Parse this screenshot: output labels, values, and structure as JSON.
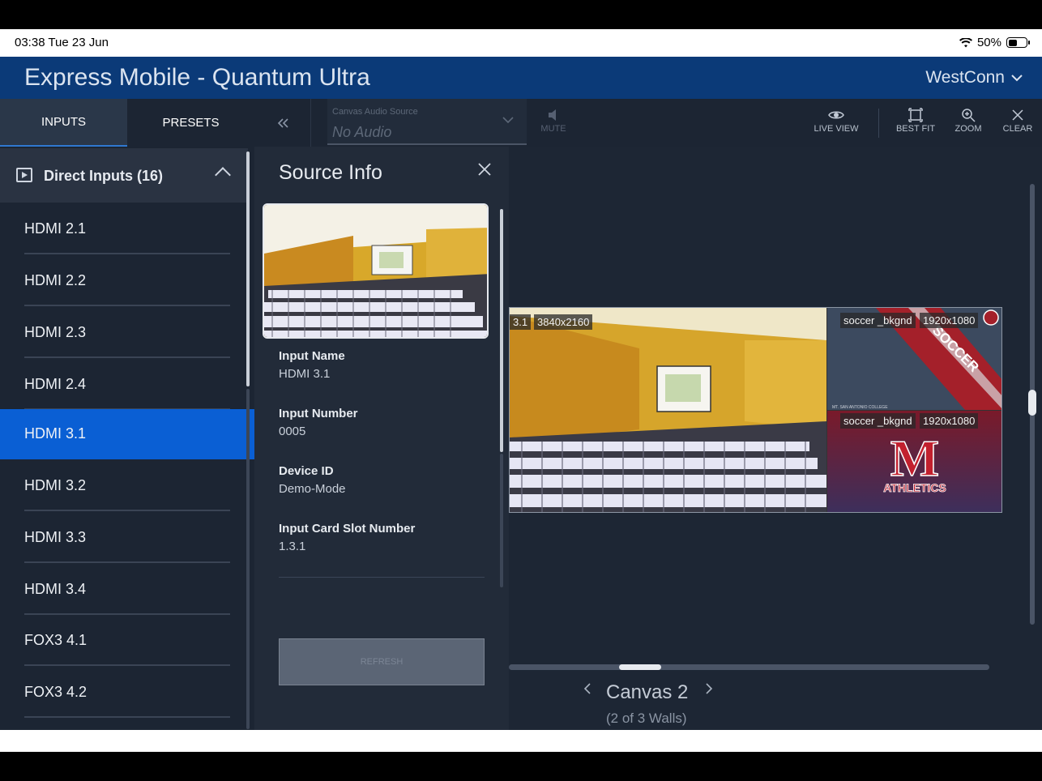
{
  "status_bar": {
    "time": "03:38  Tue 23 Jun",
    "battery": "50%"
  },
  "app": {
    "title": "Express Mobile - Quantum Ultra",
    "account": "WestConn"
  },
  "tabs": [
    {
      "label": "INPUTS"
    },
    {
      "label": "PRESETS"
    }
  ],
  "audio_source": {
    "label": "Canvas Audio Source",
    "value": "No Audio"
  },
  "toolbar": {
    "mute": "MUTE",
    "live_view": "LIVE VIEW",
    "best_fit": "BEST FIT",
    "zoom": "ZOOM",
    "clear": "CLEAR"
  },
  "inputs": {
    "group_label": "Direct Inputs (16)",
    "items": [
      {
        "label": "HDMI 2.1"
      },
      {
        "label": "HDMI 2.2"
      },
      {
        "label": "HDMI 2.3"
      },
      {
        "label": "HDMI 2.4"
      },
      {
        "label": "HDMI 3.1",
        "selected": true
      },
      {
        "label": "HDMI 3.2"
      },
      {
        "label": "HDMI 3.3"
      },
      {
        "label": "HDMI 3.4"
      },
      {
        "label": "FOX3 4.1"
      },
      {
        "label": "FOX3 4.2"
      }
    ]
  },
  "source_info": {
    "title": "Source Info",
    "fields": [
      {
        "key": "Input Name",
        "value": "HDMI 3.1"
      },
      {
        "key": "Input Number",
        "value": "0005"
      },
      {
        "key": "Device ID",
        "value": "Demo-Mode"
      },
      {
        "key": "Input Card Slot Number",
        "value": "1.3.1"
      }
    ],
    "refresh_label": "REFRESH"
  },
  "canvas": {
    "windows": [
      {
        "name_tag": "3.1",
        "res_tag": "3840x2160"
      },
      {
        "name_tag": "soccer _bkgnd",
        "res_tag": "1920x1080",
        "overlay_text": "SOCCER",
        "small_text": "MT. SAN ANTONIO COLLEGE"
      },
      {
        "name_tag": "soccer _bkgnd",
        "res_tag": "1920x1080",
        "overlay_text": "ATHLETICS",
        "logo_letter": "M"
      }
    ],
    "title": "Canvas 2",
    "subtitle": "(2 of 3 Walls)"
  },
  "colors": {
    "header": "#0b3a78",
    "accent": "#0a5fd4",
    "panel": "#1c2533"
  }
}
